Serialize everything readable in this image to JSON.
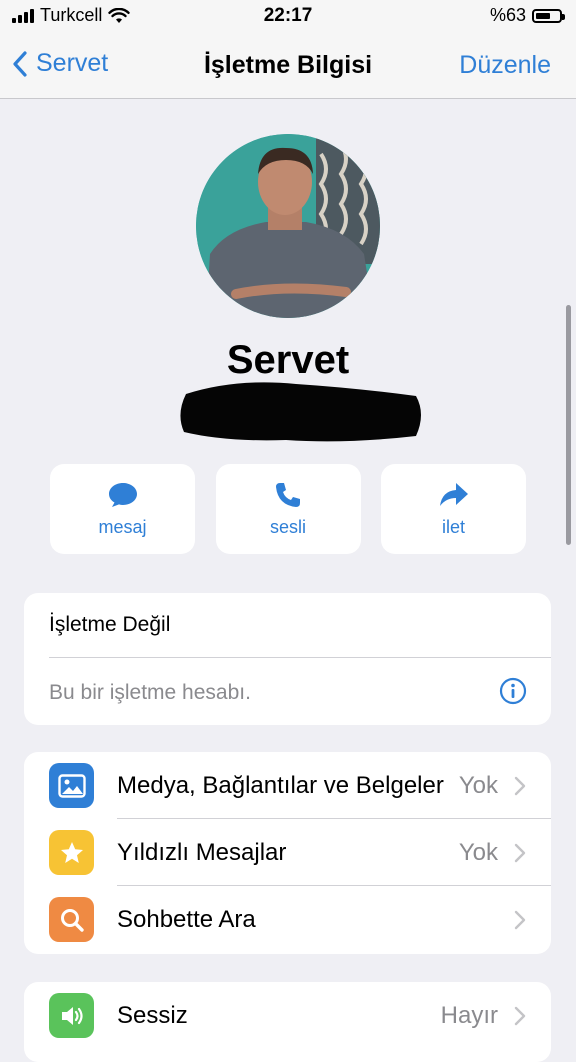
{
  "status": {
    "carrier": "Turkcell",
    "time": "22:17",
    "battery": "%63",
    "battery_level": 0.63
  },
  "nav": {
    "back_label": "Servet",
    "title": "İşletme Bilgisi",
    "edit_label": "Düzenle"
  },
  "profile": {
    "name": "Servet"
  },
  "actions": [
    {
      "label": "mesaj",
      "icon": "message-icon"
    },
    {
      "label": "sesli",
      "icon": "phone-icon"
    },
    {
      "label": "ilet",
      "icon": "share-icon"
    }
  ],
  "business": {
    "title": "İşletme Değil",
    "subtitle": "Bu bir işletme hesabı."
  },
  "list": [
    {
      "label": "Medya, Bağlantılar ve Belgeler",
      "value": "Yok",
      "icon": "photo-icon",
      "color": "#2f7fd6"
    },
    {
      "label": "Yıldızlı Mesajlar",
      "value": "Yok",
      "icon": "star-icon",
      "color": "#f7c334"
    },
    {
      "label": "Sohbette Ara",
      "value": "",
      "icon": "search-icon",
      "color": "#ef8a43"
    }
  ],
  "list2": [
    {
      "label": "Sessiz",
      "value": "Hayır",
      "icon": "speaker-icon",
      "color": "#5ac35b"
    }
  ],
  "colors": {
    "accent": "#2f7fd6",
    "background": "#efeff4"
  }
}
